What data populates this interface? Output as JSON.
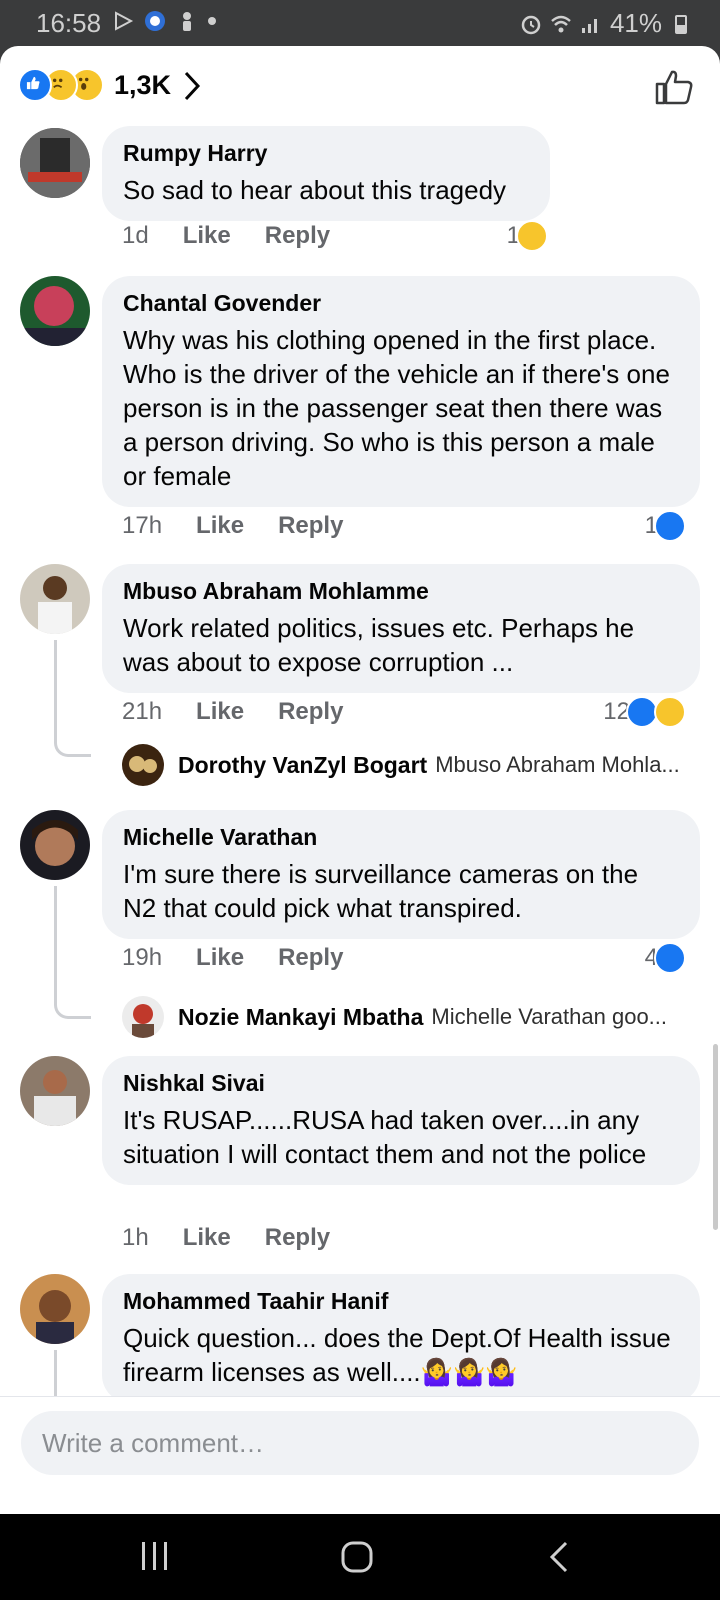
{
  "status_bar": {
    "time": "16:58",
    "battery": "41%",
    "icons": [
      "play-store-icon",
      "globe-app-icon",
      "person-icon",
      "dot-icon",
      "alarm-icon",
      "wifi-icon",
      "signal-icon",
      "battery-icon"
    ]
  },
  "header": {
    "reaction_count": "1,3K",
    "reactions": [
      "like",
      "sad",
      "wow"
    ]
  },
  "comments": [
    {
      "author": "Rumpy Harry",
      "text": "So sad to hear about this tragedy",
      "time": "1d",
      "like": "Like",
      "reply": "Reply",
      "reaction_count": "1",
      "reactions": [
        "sad"
      ]
    },
    {
      "author": "Chantal Govender",
      "text": "Why was his clothing opened in the first place. Who is the driver of the vehicle an if there's  one person is in the passenger seat then there was a person driving. So who is this person a male or female",
      "time": "17h",
      "like": "Like",
      "reply": "Reply",
      "reaction_count": "1",
      "reactions": [
        "like"
      ]
    },
    {
      "author": "Mbuso Abraham Mohlamme",
      "text": "Work related politics, issues etc. Perhaps he was about to expose corruption ...",
      "time": "21h",
      "like": "Like",
      "reply": "Reply",
      "reaction_count": "12",
      "reactions": [
        "like",
        "wow"
      ],
      "reply_preview": {
        "author": "Dorothy VanZyl Bogart",
        "text": "Mbuso Abraham Mohla..."
      }
    },
    {
      "author": "Michelle Varathan",
      "text": "I'm sure there is surveillance cameras on the N2 that could pick what transpired.",
      "time": "19h",
      "like": "Like",
      "reply": "Reply",
      "reaction_count": "4",
      "reactions": [
        "like"
      ],
      "reply_preview": {
        "author": "Nozie Mankayi Mbatha",
        "text": "Michelle Varathan goo..."
      }
    },
    {
      "author": "Nishkal Sivai",
      "text": "It's RUSAP......RUSA had taken over....in any situation I will contact them and not the police",
      "time": "1h",
      "like": "Like",
      "reply": "Reply"
    },
    {
      "author": "Mohammed Taahir Hanif",
      "text": "Quick question... does the Dept.Of Health issue firearm licenses as well....🤷‍♀️🤷‍♀️🤷‍♀️"
    }
  ],
  "composer": {
    "placeholder": "Write a comment…"
  },
  "colors": {
    "like_blue": "#1877f2",
    "bubble_bg": "#f0f2f5",
    "meta_grey": "#65676b"
  }
}
